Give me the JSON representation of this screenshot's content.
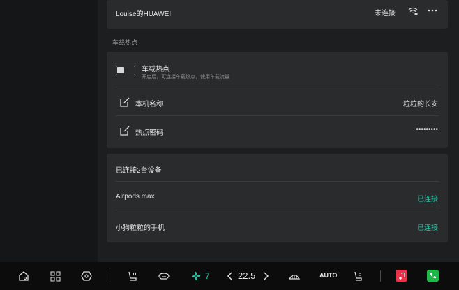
{
  "wifi": {
    "network_name": "Louise的HUAWEI",
    "status": "未连接"
  },
  "hotspot_section_title": "车载热点",
  "hotspot": {
    "title": "车载热点",
    "subtitle": "开启后，可连接车载热点，使用车载流量",
    "toggle_on": false,
    "device_name_label": "本机名称",
    "device_name_value": "粒粒的长安",
    "password_label": "热点密码",
    "password_value": "•••••••••"
  },
  "devices": {
    "title": "已连接2台设备",
    "items": [
      {
        "name": "Airpods max",
        "status": "已连接"
      },
      {
        "name": "小狗粒粒的手机",
        "status": "已连接"
      }
    ]
  },
  "bottom_bar": {
    "fan_level": "7",
    "temperature": "22.5",
    "auto_label": "AUTO"
  },
  "colors": {
    "accent": "#2ec4a8",
    "music_app": "#e8334a",
    "phone_app": "#1fb84a"
  }
}
